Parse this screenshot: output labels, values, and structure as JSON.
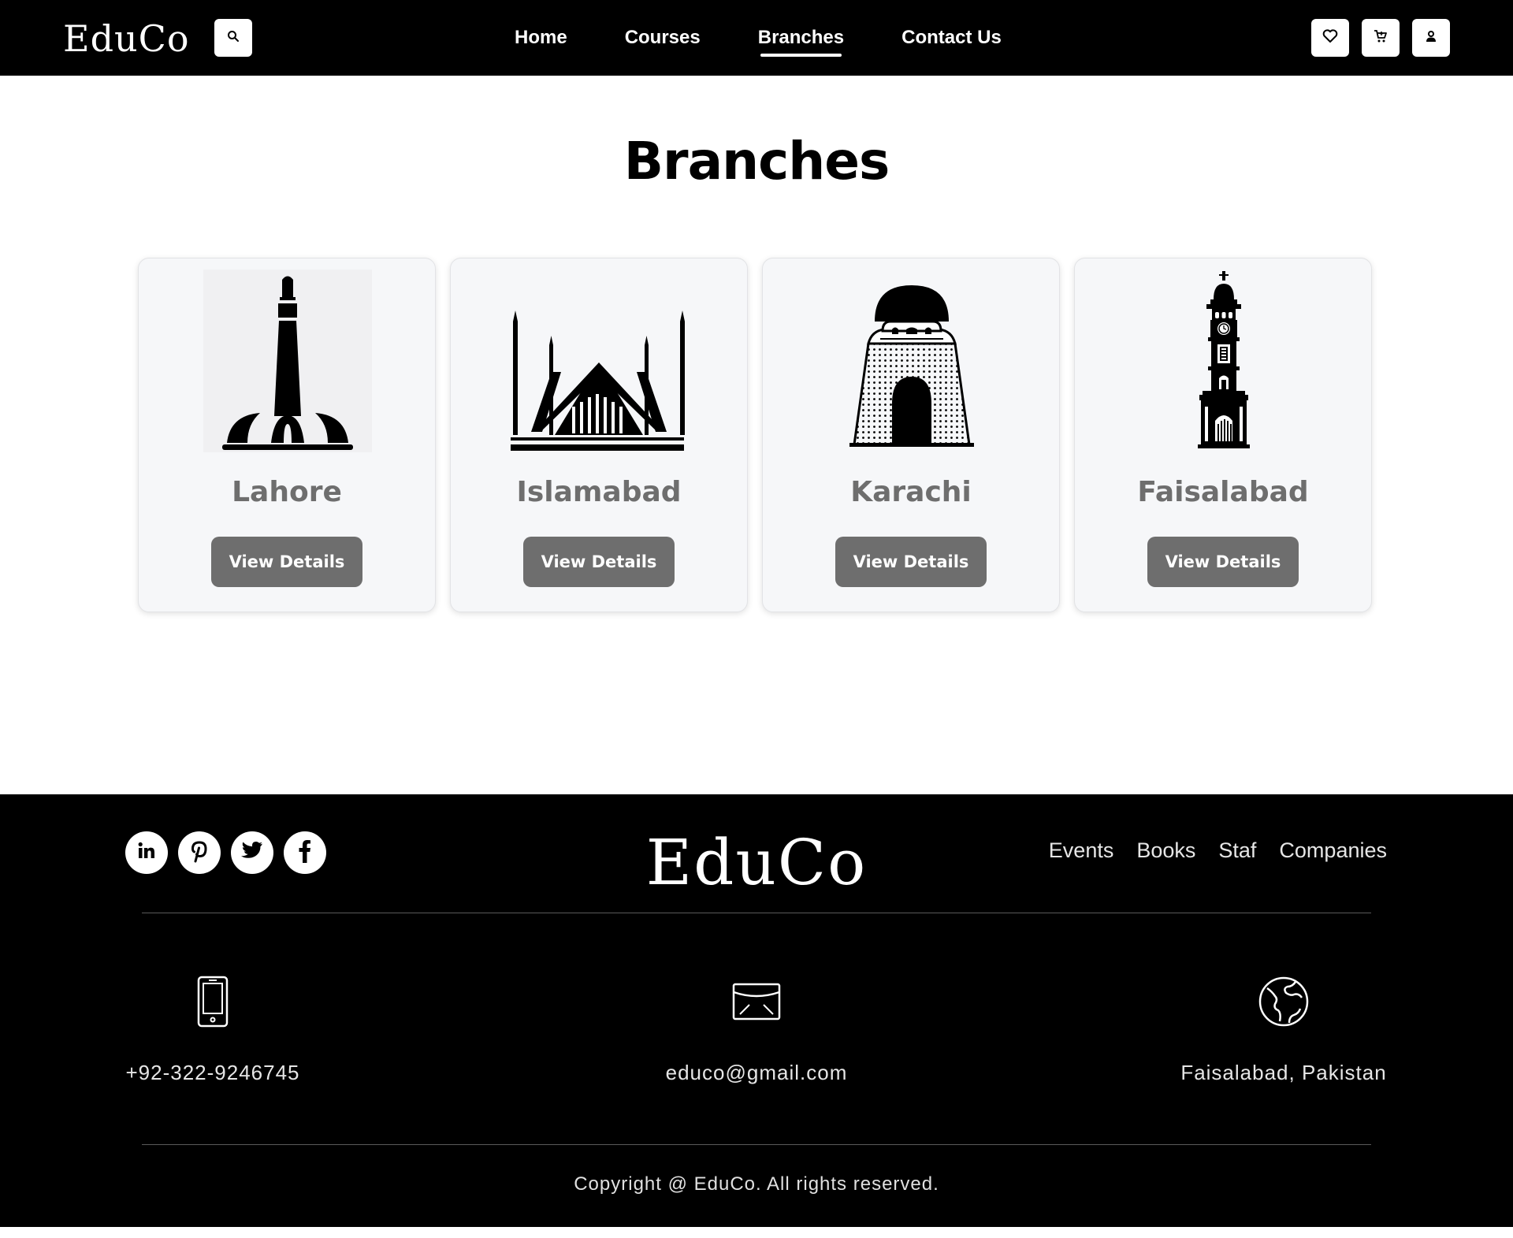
{
  "header": {
    "logo": "EduCo",
    "nav": [
      {
        "label": "Home",
        "active": false
      },
      {
        "label": "Courses",
        "active": false
      },
      {
        "label": "Branches",
        "active": true
      },
      {
        "label": "Contact Us",
        "active": false
      }
    ],
    "icons": [
      "search-icon",
      "heart-icon",
      "cart-icon",
      "user-icon"
    ]
  },
  "main": {
    "title": "Branches",
    "cards": [
      {
        "name": "Lahore",
        "button": "View Details",
        "icon": "minar-e-pakistan-icon"
      },
      {
        "name": "Islamabad",
        "button": "View Details",
        "icon": "faisal-mosque-icon"
      },
      {
        "name": "Karachi",
        "button": "View Details",
        "icon": "mazar-e-quaid-icon"
      },
      {
        "name": "Faisalabad",
        "button": "View Details",
        "icon": "clock-tower-icon"
      }
    ]
  },
  "footer": {
    "logo": "EduCo",
    "social": [
      "linkedin-icon",
      "pinterest-icon",
      "twitter-icon",
      "facebook-icon"
    ],
    "links": [
      "Events",
      "Books",
      "Staf",
      "Companies"
    ],
    "contacts": [
      {
        "icon": "phone-icon",
        "text": "+92-322-9246745"
      },
      {
        "icon": "envelope-icon",
        "text": "educo@gmail.com"
      },
      {
        "icon": "globe-icon",
        "text": "Faisalabad, Pakistan"
      }
    ],
    "copyright": "Copyright @ EduCo. All rights reserved."
  },
  "colors": {
    "header_bg": "#000000",
    "footer_bg": "#000000",
    "card_bg": "#f6f7f9",
    "button_bg": "#6e6e6e",
    "card_title": "#6e6e6e"
  }
}
